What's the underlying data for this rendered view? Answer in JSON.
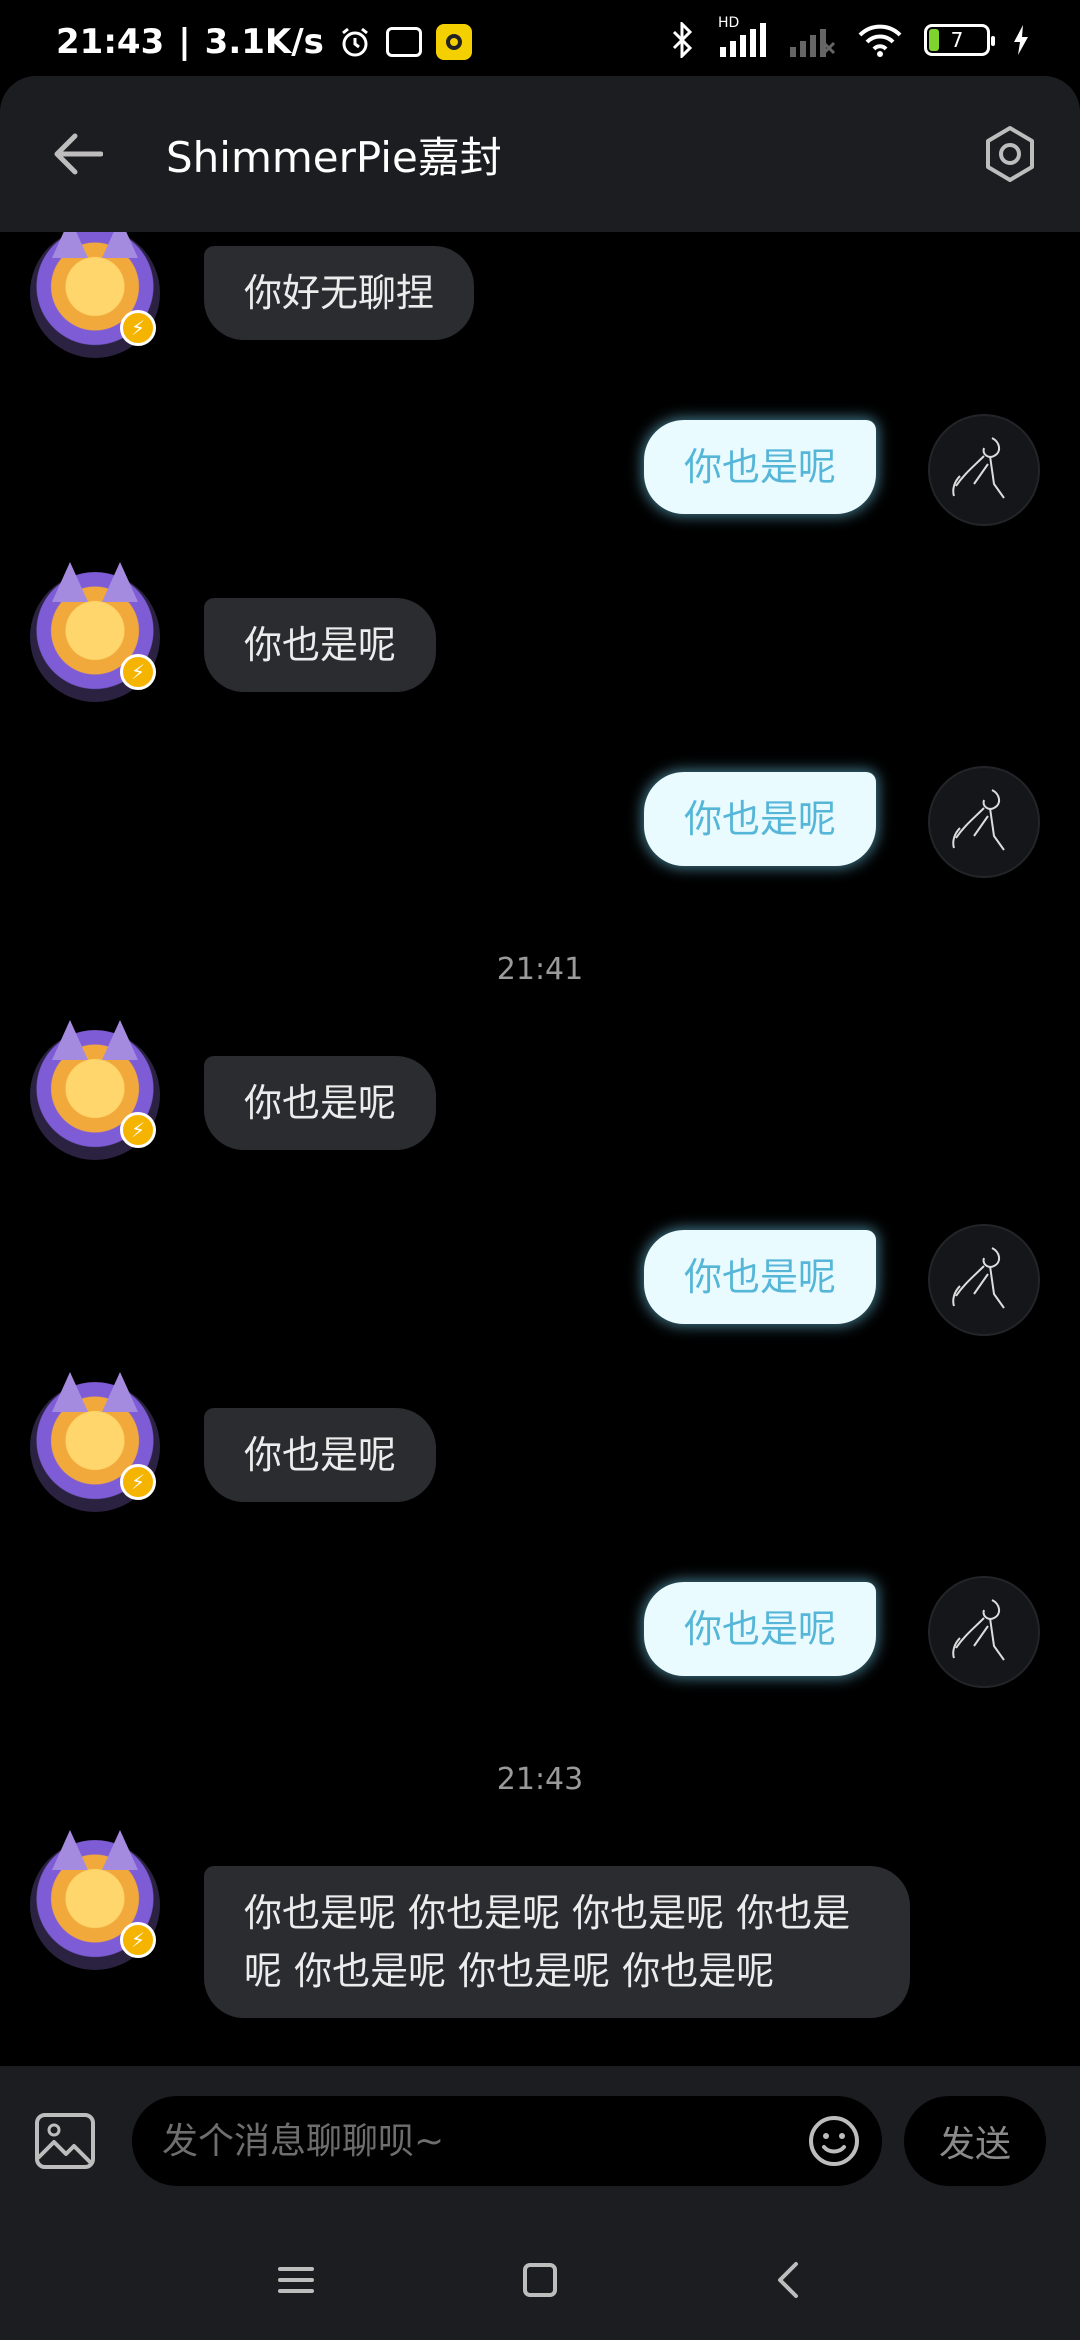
{
  "status_bar": {
    "time": "21:43",
    "network_speed": "3.1K/s",
    "battery_level": "7",
    "signal_label": "HD"
  },
  "header": {
    "title": "ShimmerPie嘉封"
  },
  "messages": [
    {
      "side": "left",
      "text": "你好无聊捏"
    },
    {
      "side": "right",
      "text": "你也是呢"
    },
    {
      "side": "left",
      "text": "你也是呢"
    },
    {
      "side": "right",
      "text": "你也是呢"
    },
    {
      "type": "time",
      "text": "21:41"
    },
    {
      "side": "left",
      "text": "你也是呢"
    },
    {
      "side": "right",
      "text": "你也是呢"
    },
    {
      "side": "left",
      "text": "你也是呢"
    },
    {
      "side": "right",
      "text": "你也是呢"
    },
    {
      "type": "time",
      "text": "21:43"
    },
    {
      "side": "left",
      "text": "你也是呢 你也是呢 你也是呢 你也是呢 你也是呢 你也是呢 你也是呢"
    }
  ],
  "input": {
    "placeholder": "发个消息聊聊呗~",
    "send_label": "发送"
  },
  "colors": {
    "accent_bubble_bg": "#e9fbff",
    "accent_bubble_text": "#55b6d8",
    "dark_bubble_bg": "#2b2c30",
    "battery_fill": "#7fd32f"
  }
}
